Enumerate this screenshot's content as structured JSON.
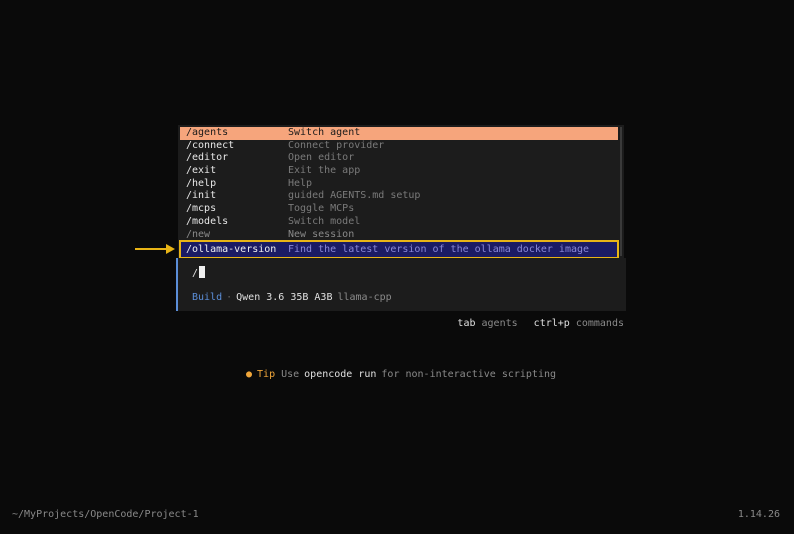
{
  "palette": {
    "commands": [
      {
        "name": "/agents",
        "desc": "Switch agent"
      },
      {
        "name": "/connect",
        "desc": "Connect provider"
      },
      {
        "name": "/editor",
        "desc": "Open editor"
      },
      {
        "name": "/exit",
        "desc": "Exit the app"
      },
      {
        "name": "/help",
        "desc": "Help"
      },
      {
        "name": "/init",
        "desc": "guided AGENTS.md setup"
      },
      {
        "name": "/mcps",
        "desc": "Toggle MCPs"
      },
      {
        "name": "/models",
        "desc": "Switch model"
      },
      {
        "name": "/new",
        "desc": "New session"
      },
      {
        "name": "/ollama-version",
        "desc": "Find the latest version of the ollama docker image"
      }
    ]
  },
  "input": {
    "value": "/",
    "mode": "Build",
    "separator": "·",
    "model": "Qwen 3.6 35B A3B",
    "provider": "llama-cpp"
  },
  "hints": {
    "tab_key": "tab",
    "tab_label": "agents",
    "cmd_key": "ctrl+p",
    "cmd_label": "commands"
  },
  "tip": {
    "bullet": "●",
    "label": "Tip",
    "pre": "Use",
    "command": "opencode run",
    "post": "for non-interactive scripting"
  },
  "footer": {
    "path": "~/MyProjects/OpenCode/Project-1",
    "version": "1.14.26"
  },
  "colors": {
    "selected_bg": "#f6a57c",
    "highlight_bg": "#1b1b64",
    "highlight_outline": "#e8b416",
    "accent_blue": "#5b8ed8",
    "tip_orange": "#f0a63a"
  }
}
